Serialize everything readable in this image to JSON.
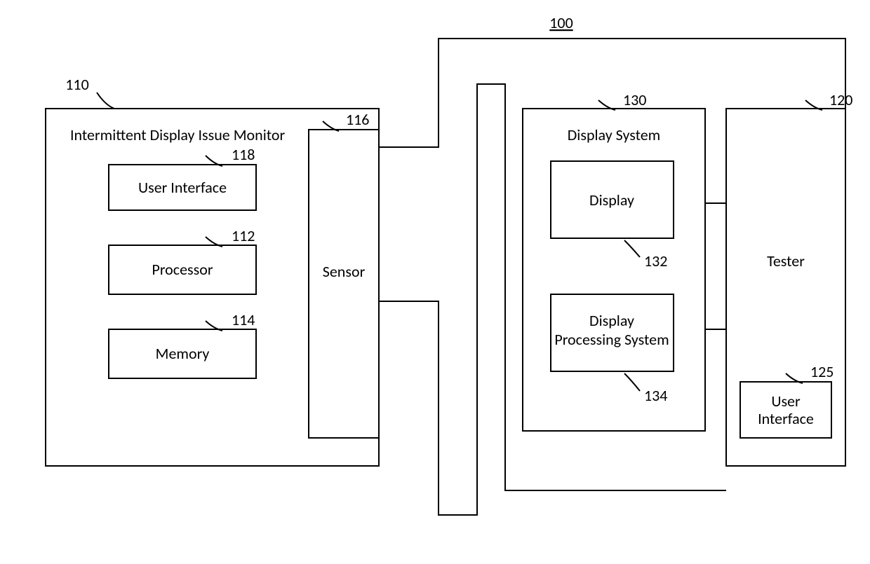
{
  "figure_ref": "100",
  "monitor": {
    "ref": "110",
    "title": "Intermittent Display Issue Monitor",
    "user_interface": {
      "label": "User Interface",
      "ref": "118"
    },
    "processor": {
      "label": "Processor",
      "ref": "112"
    },
    "memory": {
      "label": "Memory",
      "ref": "114"
    },
    "sensor": {
      "label": "Sensor",
      "ref": "116"
    }
  },
  "display_system": {
    "ref": "130",
    "title": "Display System",
    "display": {
      "label": "Display",
      "ref": "132"
    },
    "proc_system": {
      "label_line1": "Display",
      "label_line2": "Processing System",
      "ref": "134"
    }
  },
  "tester": {
    "ref": "120",
    "title": "Tester",
    "user_interface": {
      "label_line1": "User",
      "label_line2": "Interface",
      "ref": "125"
    }
  }
}
